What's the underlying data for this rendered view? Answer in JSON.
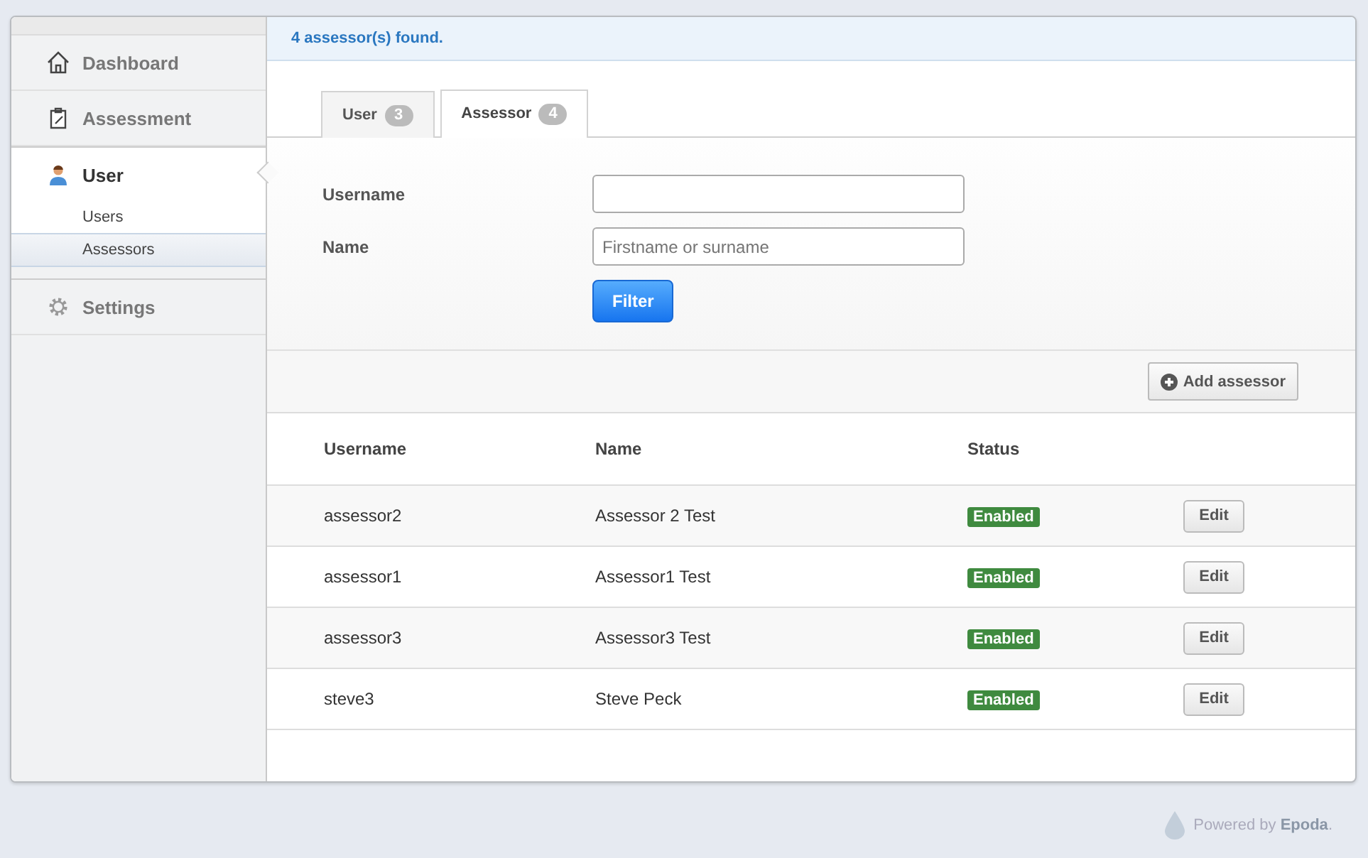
{
  "sidebar": {
    "items": [
      {
        "label": "Dashboard",
        "selected": false
      },
      {
        "label": "Assessment",
        "selected": false
      },
      {
        "label": "User",
        "selected": true,
        "children": [
          {
            "label": "Users",
            "selected": false
          },
          {
            "label": "Assessors",
            "selected": true
          }
        ]
      },
      {
        "label": "Settings",
        "selected": false
      }
    ]
  },
  "message": "4 assessor(s) found.",
  "tabs": [
    {
      "label": "User",
      "count": "3",
      "selected": false
    },
    {
      "label": "Assessor",
      "count": "4",
      "selected": true
    }
  ],
  "filter": {
    "fields": [
      {
        "label": "Username"
      },
      {
        "label": "Name",
        "placeholder": "Firstname or surname"
      }
    ],
    "button": "Filter"
  },
  "add_button": "Add assessor",
  "table": {
    "columns": [
      "Username",
      "Name",
      "Status"
    ],
    "rows": [
      {
        "username": "assessor2",
        "name": "Assessor 2 Test",
        "status": "Enabled",
        "action": "Edit"
      },
      {
        "username": "assessor1",
        "name": "Assessor1 Test",
        "status": "Enabled",
        "action": "Edit"
      },
      {
        "username": "assessor3",
        "name": "Assessor3 Test",
        "status": "Enabled",
        "action": "Edit"
      },
      {
        "username": "steve3",
        "name": "Steve Peck",
        "status": "Enabled",
        "action": "Edit"
      }
    ]
  },
  "footer": "Powered by **Epoda**."
}
